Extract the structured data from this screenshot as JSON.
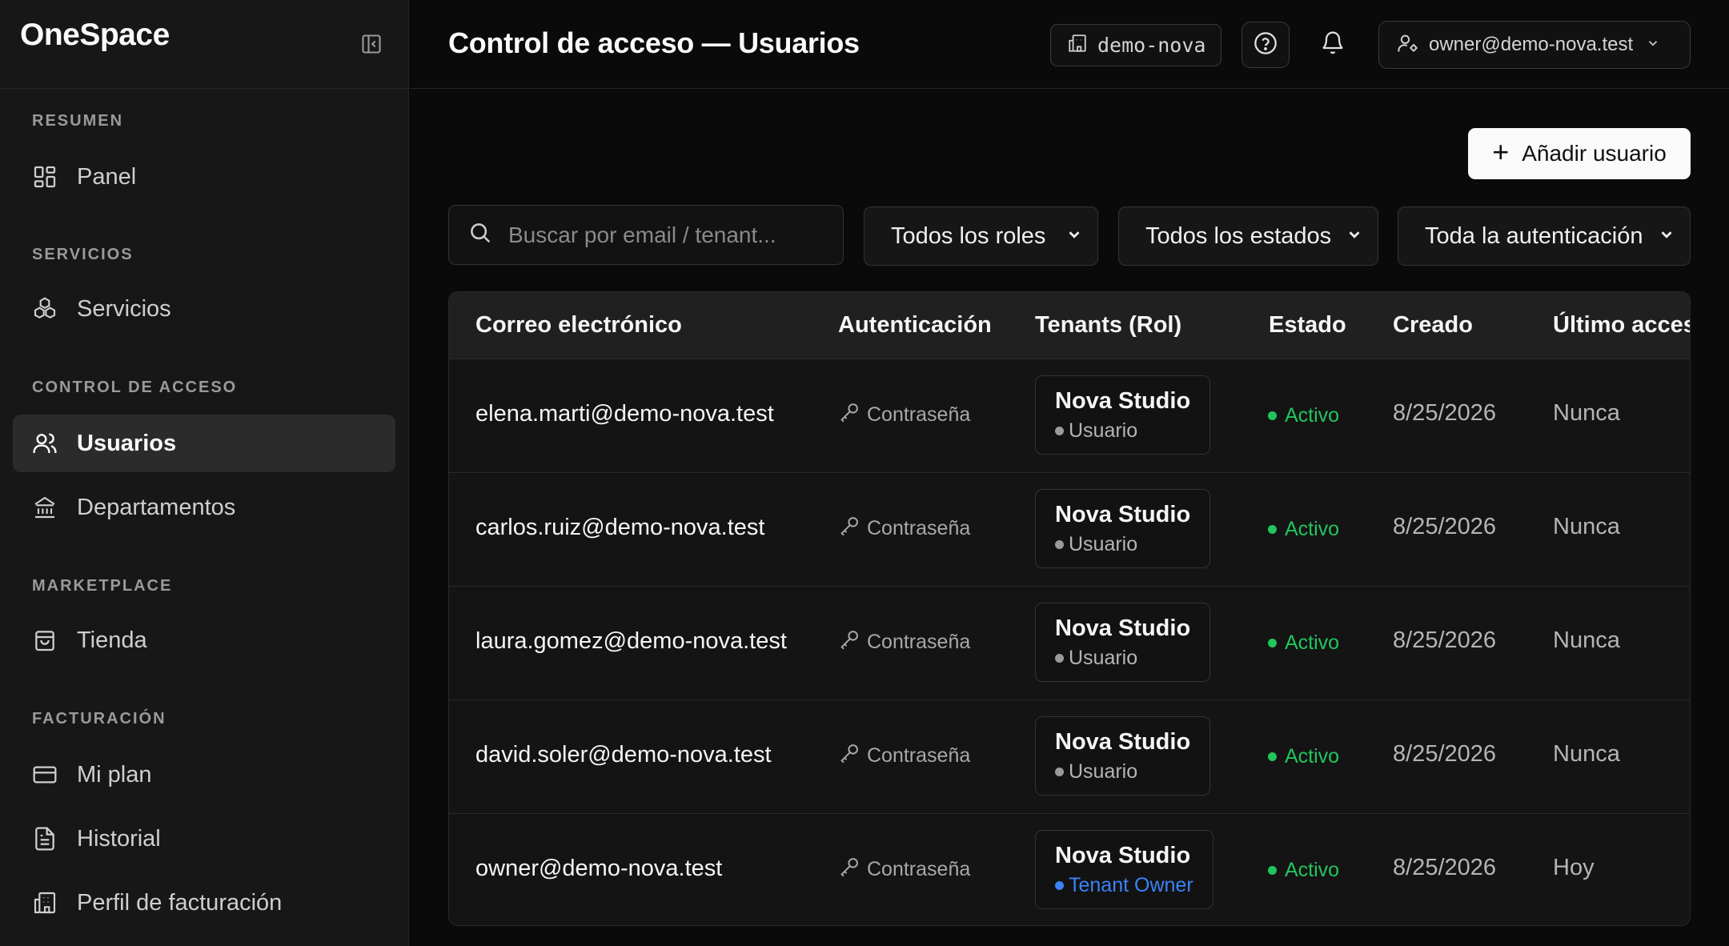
{
  "sidebar": {
    "brand": "OneSpace",
    "sections": [
      {
        "title": "RESUMEN",
        "items": [
          {
            "label": "Panel",
            "icon": "dashboard-icon"
          }
        ]
      },
      {
        "title": "SERVICIOS",
        "items": [
          {
            "label": "Servicios",
            "icon": "boxes-icon"
          }
        ]
      },
      {
        "title": "CONTROL DE ACCESO",
        "items": [
          {
            "label": "Usuarios",
            "icon": "users-icon",
            "active": true
          },
          {
            "label": "Departamentos",
            "icon": "landmark-icon"
          }
        ]
      },
      {
        "title": "MARKETPLACE",
        "items": [
          {
            "label": "Tienda",
            "icon": "shopping-bag-icon"
          }
        ]
      },
      {
        "title": "FACTURACIÓN",
        "items": [
          {
            "label": "Mi plan",
            "icon": "credit-card-icon"
          },
          {
            "label": "Historial",
            "icon": "file-text-icon"
          },
          {
            "label": "Perfil de facturación",
            "icon": "building-icon"
          }
        ]
      }
    ]
  },
  "header": {
    "title": "Control de acceso — Usuarios",
    "tenant": "demo-nova",
    "user": "owner@demo-nova.test"
  },
  "toolbar": {
    "add_user": "Añadir usuario",
    "search_placeholder": "Buscar por email / tenant...",
    "filters": {
      "roles": "Todos los roles",
      "states": "Todos los estados",
      "auth": "Toda la autenticación"
    }
  },
  "table": {
    "columns": [
      "Correo electrónico",
      "Autenticación",
      "Tenants (Rol)",
      "Estado",
      "Creado",
      "Último acceso"
    ],
    "rows": [
      {
        "email": "elena.marti@demo-nova.test",
        "auth": "Contraseña",
        "tenant": "Nova Studio",
        "role": "Usuario",
        "status": "Activo",
        "created": "8/25/2026",
        "last": "Nunca"
      },
      {
        "email": "carlos.ruiz@demo-nova.test",
        "auth": "Contraseña",
        "tenant": "Nova Studio",
        "role": "Usuario",
        "status": "Activo",
        "created": "8/25/2026",
        "last": "Nunca"
      },
      {
        "email": "laura.gomez@demo-nova.test",
        "auth": "Contraseña",
        "tenant": "Nova Studio",
        "role": "Usuario",
        "status": "Activo",
        "created": "8/25/2026",
        "last": "Nunca"
      },
      {
        "email": "david.soler@demo-nova.test",
        "auth": "Contraseña",
        "tenant": "Nova Studio",
        "role": "Usuario",
        "status": "Activo",
        "created": "8/25/2026",
        "last": "Nunca"
      },
      {
        "email": "owner@demo-nova.test",
        "auth": "Contraseña",
        "tenant": "Nova Studio",
        "role": "Tenant Owner",
        "status": "Activo",
        "created": "8/25/2026",
        "last": "Hoy"
      }
    ]
  },
  "colors": {
    "active_status": "#22c55e",
    "owner_role": "#3b82f6",
    "user_role": "#9a9a9a"
  }
}
